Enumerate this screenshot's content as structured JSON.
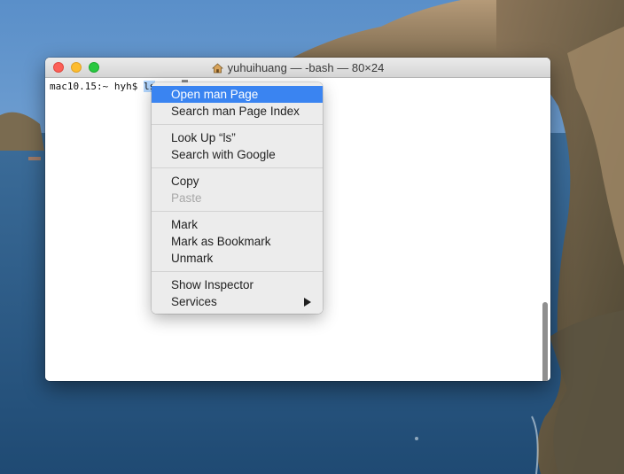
{
  "window": {
    "title": "yuhuihuang — -bash — 80×24"
  },
  "terminal": {
    "prompt": "mac10.15:~ hyh$ ",
    "selected_word": "ls"
  },
  "context_menu": {
    "groups": [
      [
        {
          "label": "Open man Page",
          "state": "highlighted"
        },
        {
          "label": "Search man Page Index",
          "state": "normal"
        }
      ],
      [
        {
          "label": "Look Up “ls”",
          "state": "normal"
        },
        {
          "label": "Search with Google",
          "state": "normal"
        }
      ],
      [
        {
          "label": "Copy",
          "state": "normal"
        },
        {
          "label": "Paste",
          "state": "disabled"
        }
      ],
      [
        {
          "label": "Mark",
          "state": "normal"
        },
        {
          "label": "Mark as Bookmark",
          "state": "normal"
        },
        {
          "label": "Unmark",
          "state": "normal"
        }
      ],
      [
        {
          "label": "Show Inspector",
          "state": "normal"
        },
        {
          "label": "Services",
          "state": "normal",
          "submenu": true
        }
      ]
    ]
  },
  "colors": {
    "highlight": "#3a84f1",
    "close": "#fc5f57",
    "minimize": "#fdbc2e",
    "maximize": "#28c840"
  }
}
